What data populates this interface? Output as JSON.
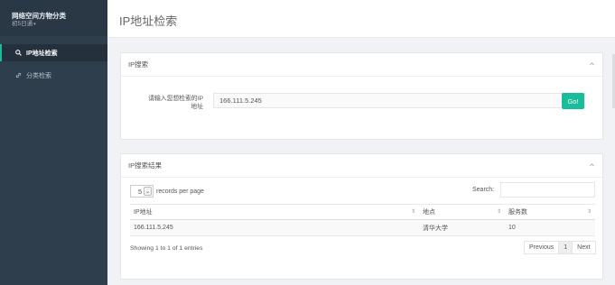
{
  "sidebar": {
    "brand_title": "网络空间方物分类",
    "brand_sub": "初5日通",
    "items": [
      {
        "label": "IP地址检索",
        "icon": "search-icon",
        "active": true
      },
      {
        "label": "分类检索",
        "icon": "link-icon",
        "active": false
      }
    ]
  },
  "header": {
    "title": "IP地址检索"
  },
  "search_panel": {
    "title": "IP搜索",
    "label": "请输入您想检索的IP地址",
    "input_value": "166.111.5.245",
    "button": "Go!"
  },
  "results_panel": {
    "title": "IP搜索结果",
    "page_length": "5",
    "records_label": "records per page",
    "search_label": "Search:",
    "columns": [
      "IP地址",
      "地点",
      "服务数"
    ],
    "rows": [
      [
        "166.111.5.245",
        "清华大学",
        "10"
      ]
    ],
    "info": "Showing 1 to 1 of 1 entries",
    "pagination": {
      "prev": "Previous",
      "current": "1",
      "next": "Next"
    }
  },
  "colors": {
    "accent": "#1abc9c",
    "sidebar_bg": "#2f3e4c"
  }
}
